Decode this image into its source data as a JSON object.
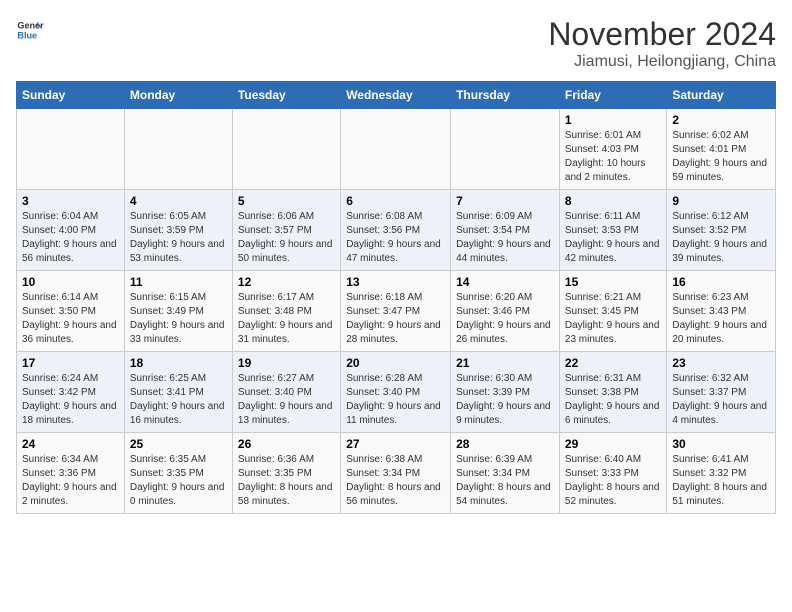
{
  "logo": {
    "line1": "General",
    "line2": "Blue"
  },
  "title": "November 2024",
  "subtitle": "Jiamusi, Heilongjiang, China",
  "days_of_week": [
    "Sunday",
    "Monday",
    "Tuesday",
    "Wednesday",
    "Thursday",
    "Friday",
    "Saturday"
  ],
  "weeks": [
    [
      {
        "day": "",
        "info": ""
      },
      {
        "day": "",
        "info": ""
      },
      {
        "day": "",
        "info": ""
      },
      {
        "day": "",
        "info": ""
      },
      {
        "day": "",
        "info": ""
      },
      {
        "day": "1",
        "info": "Sunrise: 6:01 AM\nSunset: 4:03 PM\nDaylight: 10 hours\nand 2 minutes."
      },
      {
        "day": "2",
        "info": "Sunrise: 6:02 AM\nSunset: 4:01 PM\nDaylight: 9 hours\nand 59 minutes."
      }
    ],
    [
      {
        "day": "3",
        "info": "Sunrise: 6:04 AM\nSunset: 4:00 PM\nDaylight: 9 hours\nand 56 minutes."
      },
      {
        "day": "4",
        "info": "Sunrise: 6:05 AM\nSunset: 3:59 PM\nDaylight: 9 hours\nand 53 minutes."
      },
      {
        "day": "5",
        "info": "Sunrise: 6:06 AM\nSunset: 3:57 PM\nDaylight: 9 hours\nand 50 minutes."
      },
      {
        "day": "6",
        "info": "Sunrise: 6:08 AM\nSunset: 3:56 PM\nDaylight: 9 hours\nand 47 minutes."
      },
      {
        "day": "7",
        "info": "Sunrise: 6:09 AM\nSunset: 3:54 PM\nDaylight: 9 hours\nand 44 minutes."
      },
      {
        "day": "8",
        "info": "Sunrise: 6:11 AM\nSunset: 3:53 PM\nDaylight: 9 hours\nand 42 minutes."
      },
      {
        "day": "9",
        "info": "Sunrise: 6:12 AM\nSunset: 3:52 PM\nDaylight: 9 hours\nand 39 minutes."
      }
    ],
    [
      {
        "day": "10",
        "info": "Sunrise: 6:14 AM\nSunset: 3:50 PM\nDaylight: 9 hours\nand 36 minutes."
      },
      {
        "day": "11",
        "info": "Sunrise: 6:15 AM\nSunset: 3:49 PM\nDaylight: 9 hours\nand 33 minutes."
      },
      {
        "day": "12",
        "info": "Sunrise: 6:17 AM\nSunset: 3:48 PM\nDaylight: 9 hours\nand 31 minutes."
      },
      {
        "day": "13",
        "info": "Sunrise: 6:18 AM\nSunset: 3:47 PM\nDaylight: 9 hours\nand 28 minutes."
      },
      {
        "day": "14",
        "info": "Sunrise: 6:20 AM\nSunset: 3:46 PM\nDaylight: 9 hours\nand 26 minutes."
      },
      {
        "day": "15",
        "info": "Sunrise: 6:21 AM\nSunset: 3:45 PM\nDaylight: 9 hours\nand 23 minutes."
      },
      {
        "day": "16",
        "info": "Sunrise: 6:23 AM\nSunset: 3:43 PM\nDaylight: 9 hours\nand 20 minutes."
      }
    ],
    [
      {
        "day": "17",
        "info": "Sunrise: 6:24 AM\nSunset: 3:42 PM\nDaylight: 9 hours\nand 18 minutes."
      },
      {
        "day": "18",
        "info": "Sunrise: 6:25 AM\nSunset: 3:41 PM\nDaylight: 9 hours\nand 16 minutes."
      },
      {
        "day": "19",
        "info": "Sunrise: 6:27 AM\nSunset: 3:40 PM\nDaylight: 9 hours\nand 13 minutes."
      },
      {
        "day": "20",
        "info": "Sunrise: 6:28 AM\nSunset: 3:40 PM\nDaylight: 9 hours\nand 11 minutes."
      },
      {
        "day": "21",
        "info": "Sunrise: 6:30 AM\nSunset: 3:39 PM\nDaylight: 9 hours\nand 9 minutes."
      },
      {
        "day": "22",
        "info": "Sunrise: 6:31 AM\nSunset: 3:38 PM\nDaylight: 9 hours\nand 6 minutes."
      },
      {
        "day": "23",
        "info": "Sunrise: 6:32 AM\nSunset: 3:37 PM\nDaylight: 9 hours\nand 4 minutes."
      }
    ],
    [
      {
        "day": "24",
        "info": "Sunrise: 6:34 AM\nSunset: 3:36 PM\nDaylight: 9 hours\nand 2 minutes."
      },
      {
        "day": "25",
        "info": "Sunrise: 6:35 AM\nSunset: 3:35 PM\nDaylight: 9 hours\nand 0 minutes."
      },
      {
        "day": "26",
        "info": "Sunrise: 6:36 AM\nSunset: 3:35 PM\nDaylight: 8 hours\nand 58 minutes."
      },
      {
        "day": "27",
        "info": "Sunrise: 6:38 AM\nSunset: 3:34 PM\nDaylight: 8 hours\nand 56 minutes."
      },
      {
        "day": "28",
        "info": "Sunrise: 6:39 AM\nSunset: 3:34 PM\nDaylight: 8 hours\nand 54 minutes."
      },
      {
        "day": "29",
        "info": "Sunrise: 6:40 AM\nSunset: 3:33 PM\nDaylight: 8 hours\nand 52 minutes."
      },
      {
        "day": "30",
        "info": "Sunrise: 6:41 AM\nSunset: 3:32 PM\nDaylight: 8 hours\nand 51 minutes."
      }
    ]
  ]
}
